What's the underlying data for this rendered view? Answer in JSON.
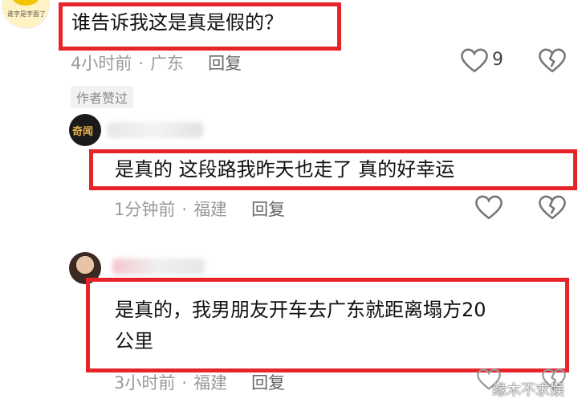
{
  "comments": [
    {
      "text": "谁告诉我这是真是假的？",
      "time": "4小时前",
      "location": "广东",
      "reply_label": "回复",
      "like_count": "9",
      "badge": "作者赞过",
      "avatar_text": "谁字是字面了"
    },
    {
      "text": "是真的 这段路我昨天也走了 真的好幸运",
      "time": "1分钟前",
      "location": "福建",
      "reply_label": "回复",
      "avatar_text": "奇闻"
    },
    {
      "text_line1": "是真的，我男朋友开车去广东就距离塌方20",
      "text_line2": "公里",
      "time": "3小时前",
      "location": "福建",
      "reply_label": "回复"
    }
  ],
  "separator": "·",
  "watermark": "缘木不求娱",
  "colors": {
    "highlight": "#e8242b",
    "meta": "#9a9a9a"
  }
}
